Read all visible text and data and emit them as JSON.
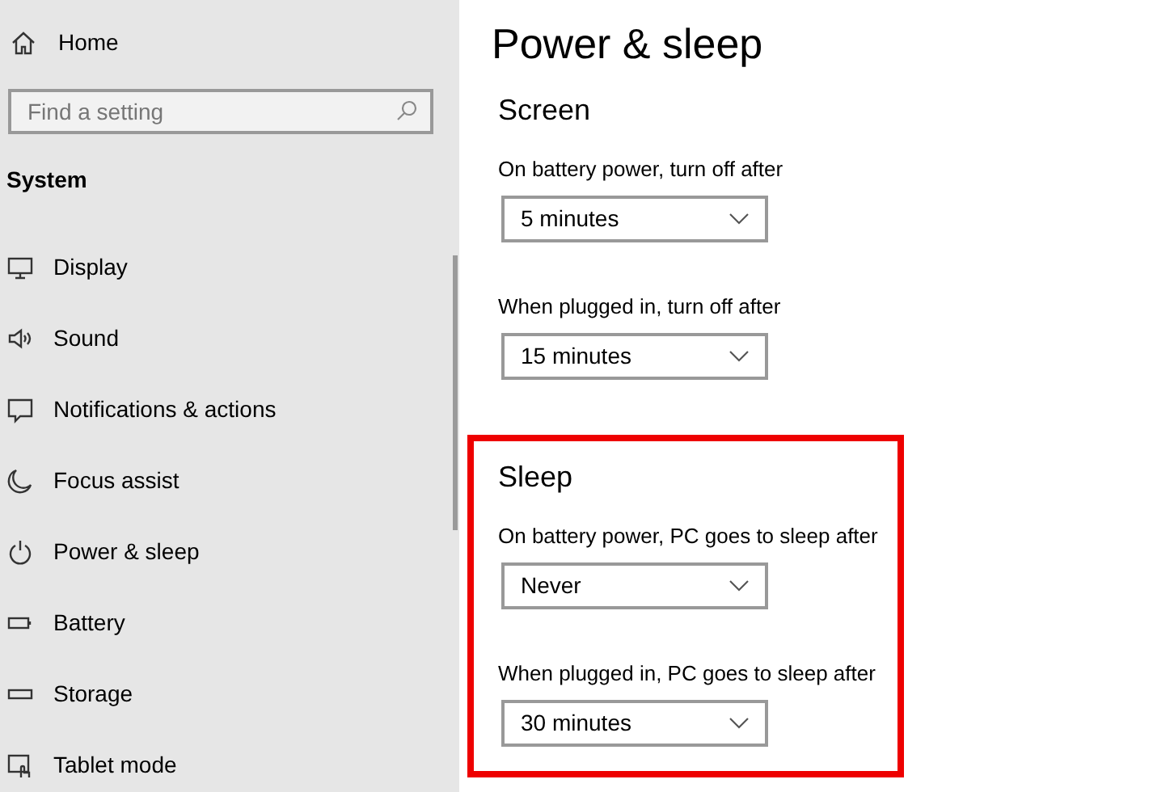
{
  "sidebar": {
    "home": {
      "label": "Home"
    },
    "search": {
      "placeholder": "Find a setting"
    },
    "section_title": "System",
    "items": [
      {
        "label": "Display"
      },
      {
        "label": "Sound"
      },
      {
        "label": "Notifications & actions"
      },
      {
        "label": "Focus assist"
      },
      {
        "label": "Power & sleep"
      },
      {
        "label": "Battery"
      },
      {
        "label": "Storage"
      },
      {
        "label": "Tablet mode"
      }
    ]
  },
  "main": {
    "title": "Power & sleep",
    "sections": [
      {
        "heading": "Screen",
        "highlighted": false,
        "settings": [
          {
            "label": "On battery power, turn off after",
            "value": "5 minutes"
          },
          {
            "label": "When plugged in, turn off after",
            "value": "15 minutes"
          }
        ]
      },
      {
        "heading": "Sleep",
        "highlighted": true,
        "settings": [
          {
            "label": "On battery power, PC goes to sleep after",
            "value": "Never"
          },
          {
            "label": "When plugged in, PC goes to sleep after",
            "value": "30 minutes"
          }
        ]
      }
    ]
  }
}
